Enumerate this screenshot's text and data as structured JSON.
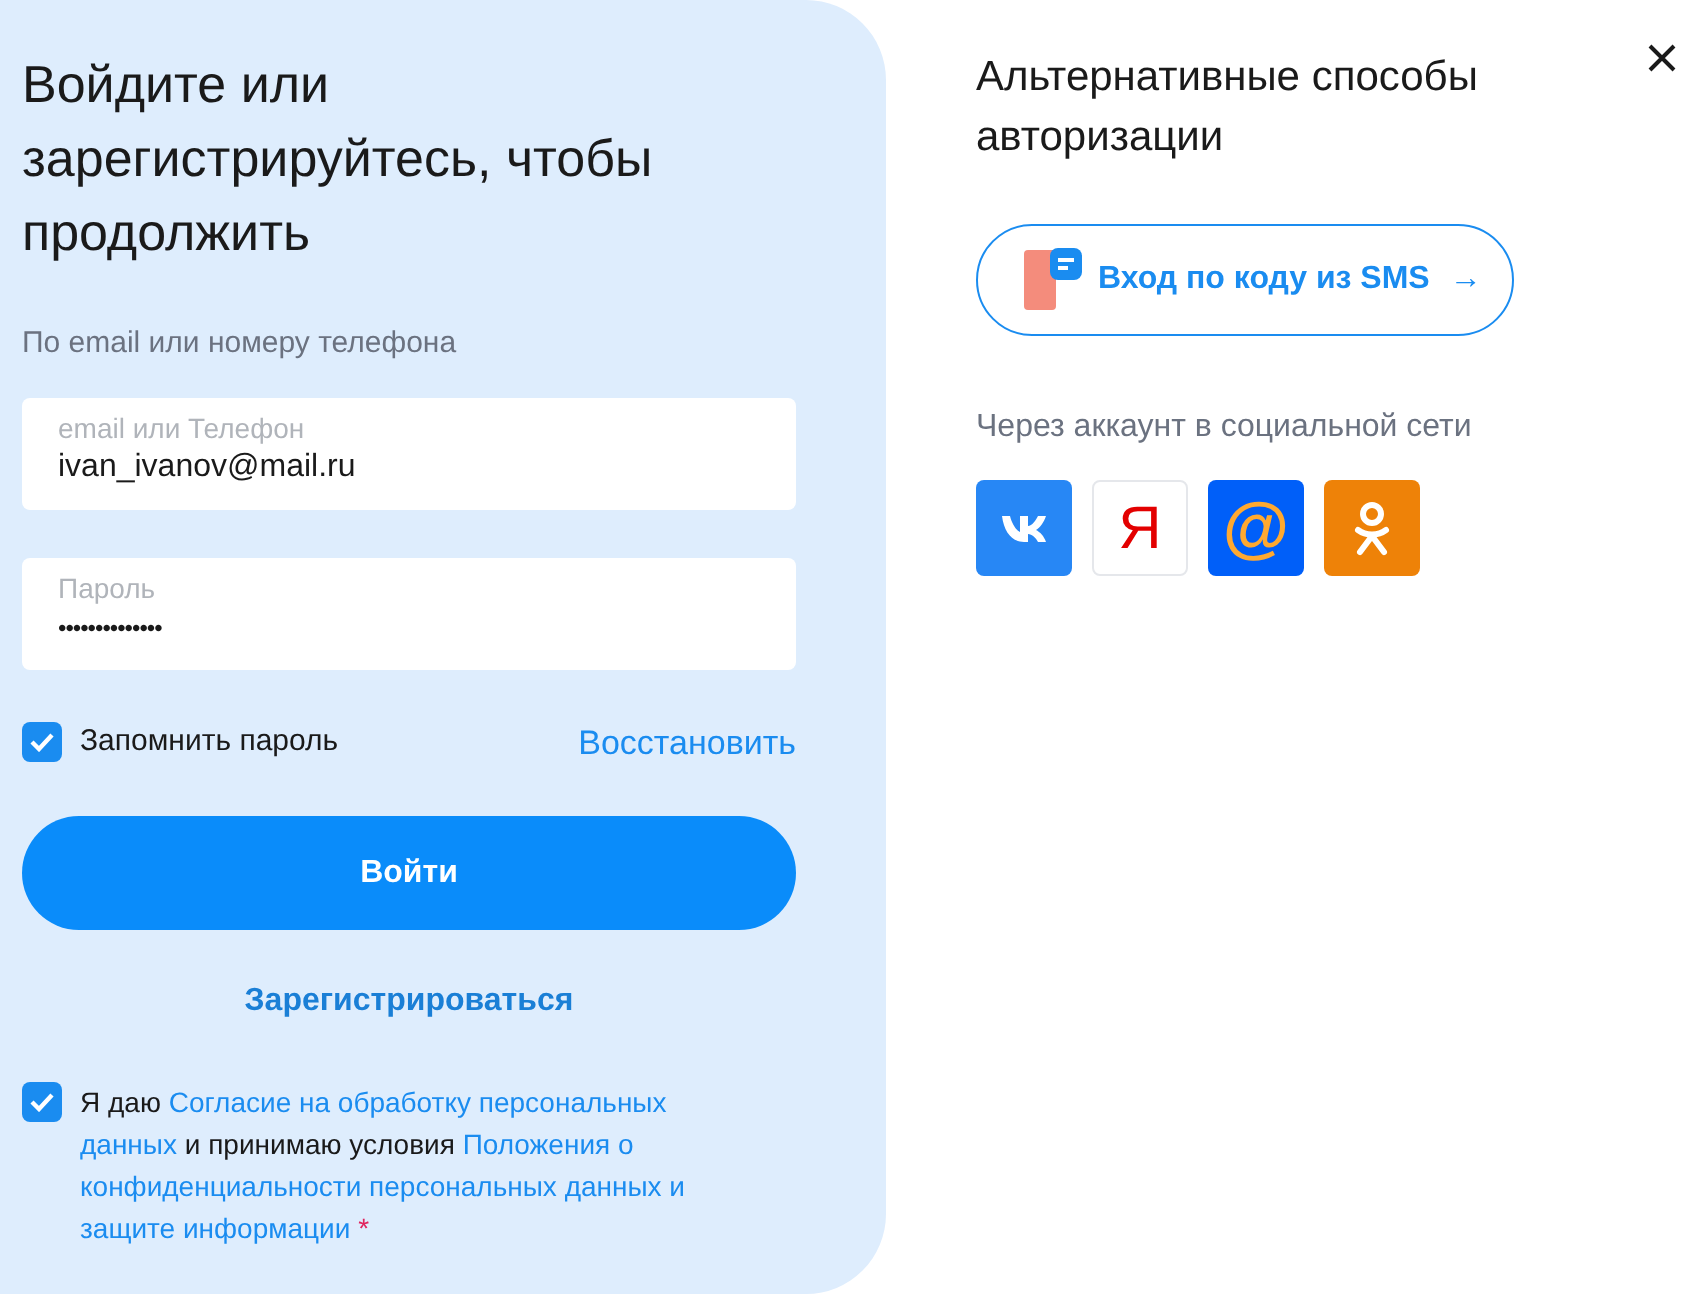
{
  "login": {
    "title": "Войдите или зарегистрируйтесь, чтобы продолжить",
    "subtitle": "По email или номеру телефона",
    "fields": [
      {
        "label": "email или Телефон",
        "value": "ivan_ivanov@mail.ru"
      },
      {
        "label": "Пароль",
        "value": "••••••••••••••"
      }
    ],
    "remember": {
      "label": "Запомнить пароль",
      "checked": true
    },
    "restore_link": "Восстановить",
    "submit": "Войти",
    "register_link": "Зарегистрироваться",
    "consent": {
      "checked": true,
      "parts": [
        {
          "text": "Я даю",
          "link": false
        },
        {
          "text": "Согласие на обработку персональных",
          "link": true
        },
        {
          "text": "данных",
          "link": true
        },
        {
          "text": "и принимаю условия",
          "link": false
        },
        {
          "text": "Положения о",
          "link": true
        },
        {
          "text": "конфиденциальности персональных данных и",
          "link": true
        },
        {
          "text": "защите информации",
          "link": true
        }
      ],
      "required_mark": "*"
    }
  },
  "alternatives": {
    "title": "Альтернативные способы авторизации",
    "sms_button": "Вход по коду из SMS",
    "arrow": "→",
    "social_label": "Через аккаунт в социальной сети",
    "social": [
      {
        "kind": "vk",
        "color": "#2787f5"
      },
      {
        "kind": "glyph",
        "glyph": "Я",
        "color": "#ffffff"
      },
      {
        "kind": "glyph",
        "glyph": "@",
        "color": "#005ff9"
      },
      {
        "kind": "ok",
        "color": "#ee8208"
      }
    ]
  }
}
